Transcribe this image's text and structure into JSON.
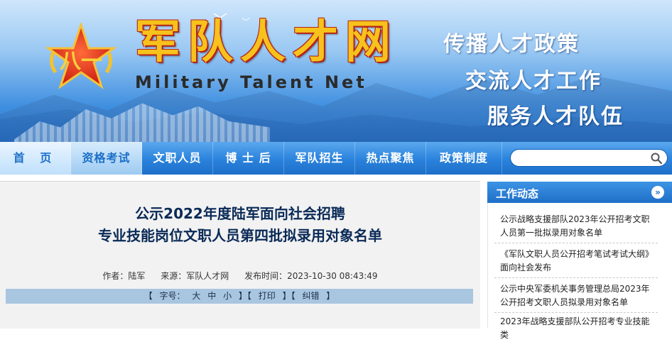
{
  "header": {
    "title": "军队人才网",
    "subtitle_en": "Military Talent Net",
    "slogans": [
      "传播人才政策",
      "交流人才工作",
      "服务人才队伍"
    ]
  },
  "nav": {
    "items": [
      {
        "label": "首 页"
      },
      {
        "label": "资格考试"
      },
      {
        "label": "文职人员"
      },
      {
        "label": "博 士 后"
      },
      {
        "label": "军队招生"
      },
      {
        "label": "热点聚焦"
      },
      {
        "label": "政策制度"
      }
    ],
    "active_index": 1,
    "search_placeholder": ""
  },
  "article": {
    "title_line1": "公示2022年度陆军面向社会招聘",
    "title_line2": "专业技能岗位文职人员第四批拟录用对象名单",
    "author": "作者：陆军",
    "source": "来源：军队人才网",
    "published": "发布时间：2023-10-30 08:43:49",
    "toolbar": {
      "open1": "【",
      "font_label": "字号：",
      "big": "大",
      "mid": "中",
      "small": "小",
      "close_open1": "】【",
      "print": "打印",
      "close_open2": "】【",
      "error": "纠错",
      "close": "】"
    }
  },
  "sidebar": {
    "title": "工作动态",
    "more": "»",
    "items": [
      {
        "text": "公示战略支援部队2023年公开招考文职人员第一批拟录用对象名单"
      },
      {
        "text": "《军队文职人员公开招考笔试考试大纲》面向社会发布"
      },
      {
        "text": "公示中央军委机关事务管理总局2023年公开招考文职人员拟录用对象名单"
      },
      {
        "text": "2023年战略支援部队公开招考专业技能类"
      }
    ]
  },
  "colors": {
    "nav_blue": "#2a82dc",
    "title_gold": "#f7c21c",
    "title_red": "#b52419",
    "article_title": "#0a2a57"
  }
}
